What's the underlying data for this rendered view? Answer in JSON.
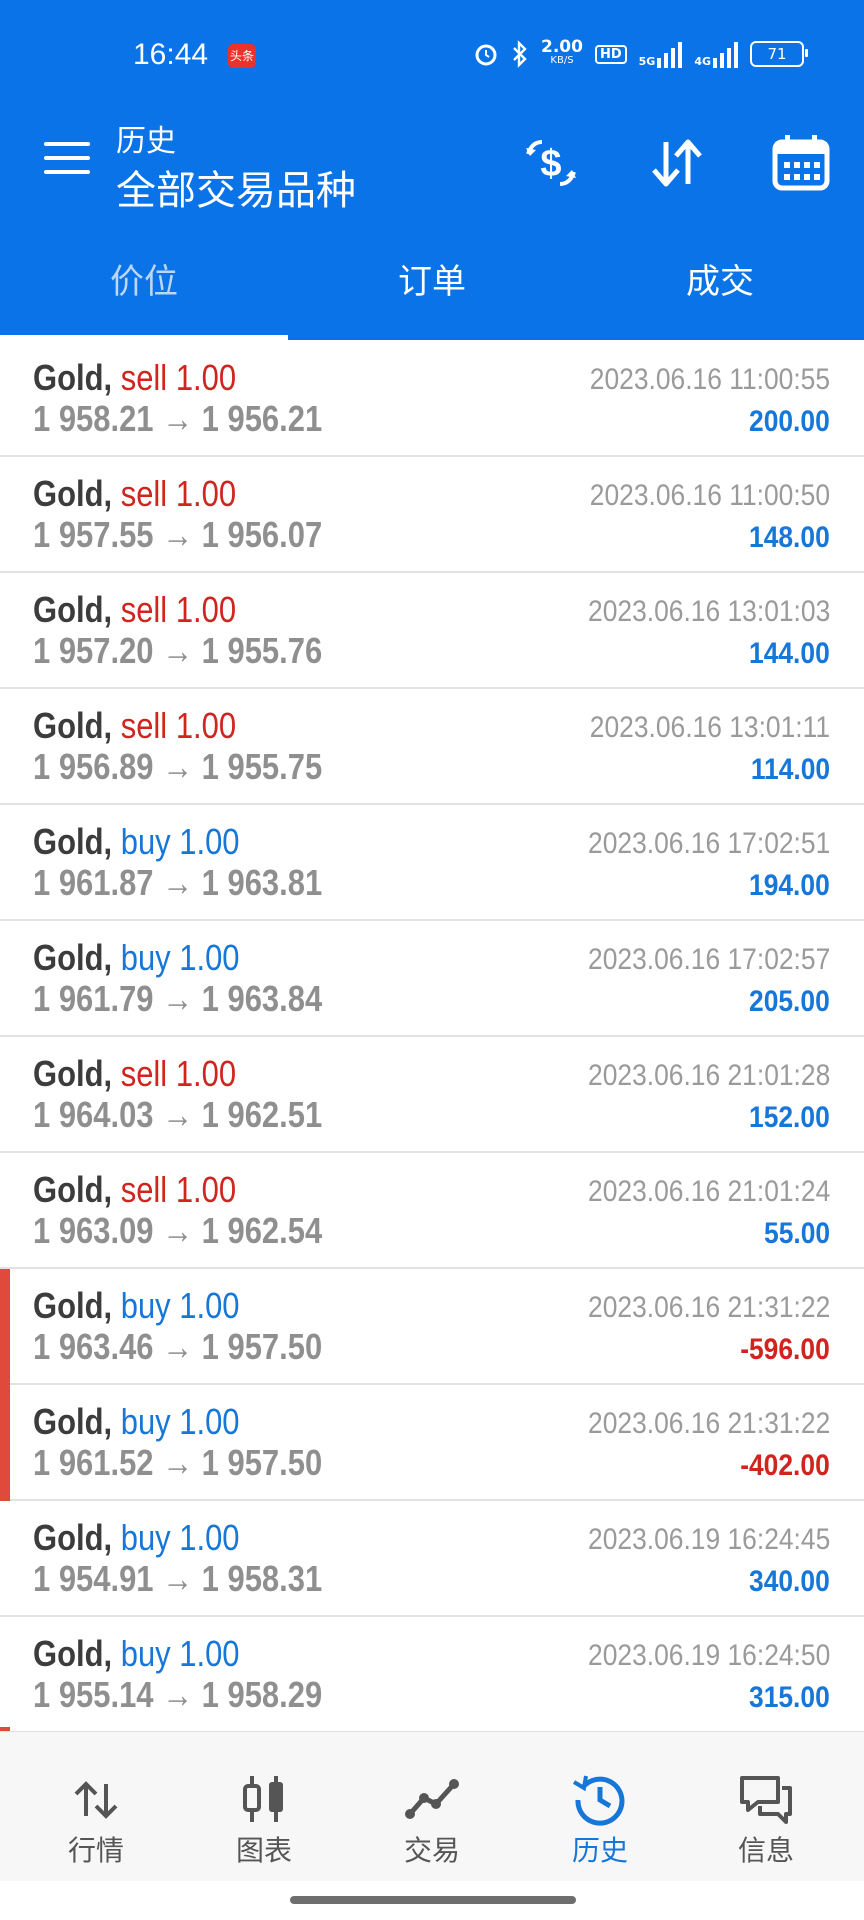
{
  "status_bar": {
    "time": "16:44",
    "badge": "头条",
    "net_speed": "2.00",
    "net_unit": "KB/S",
    "hd": "HD",
    "net1": "5G",
    "net2": "4G",
    "battery": "71"
  },
  "header": {
    "title_small": "历史",
    "title_large": "全部交易品种"
  },
  "tabs": [
    {
      "label": "价位",
      "active": true
    },
    {
      "label": "订单",
      "active": false
    },
    {
      "label": "成交",
      "active": false
    }
  ],
  "trades": [
    {
      "symbol": "Gold,",
      "side": "sell",
      "volume": "1.00",
      "prices": "1 958.21 → 1 956.21",
      "time": "2023.06.16 11:00:55",
      "profit": "200.00"
    },
    {
      "symbol": "Gold,",
      "side": "sell",
      "volume": "1.00",
      "prices": "1 957.55 → 1 956.07",
      "time": "2023.06.16 11:00:50",
      "profit": "148.00"
    },
    {
      "symbol": "Gold,",
      "side": "sell",
      "volume": "1.00",
      "prices": "1 957.20 → 1 955.76",
      "time": "2023.06.16 13:01:03",
      "profit": "144.00"
    },
    {
      "symbol": "Gold,",
      "side": "sell",
      "volume": "1.00",
      "prices": "1 956.89 → 1 955.75",
      "time": "2023.06.16 13:01:11",
      "profit": "114.00"
    },
    {
      "symbol": "Gold,",
      "side": "buy",
      "volume": "1.00",
      "prices": "1 961.87 → 1 963.81",
      "time": "2023.06.16 17:02:51",
      "profit": "194.00"
    },
    {
      "symbol": "Gold,",
      "side": "buy",
      "volume": "1.00",
      "prices": "1 961.79 → 1 963.84",
      "time": "2023.06.16 17:02:57",
      "profit": "205.00"
    },
    {
      "symbol": "Gold,",
      "side": "sell",
      "volume": "1.00",
      "prices": "1 964.03 → 1 962.51",
      "time": "2023.06.16 21:01:28",
      "profit": "152.00"
    },
    {
      "symbol": "Gold,",
      "side": "sell",
      "volume": "1.00",
      "prices": "1 963.09 → 1 962.54",
      "time": "2023.06.16 21:01:24",
      "profit": "55.00"
    },
    {
      "symbol": "Gold,",
      "side": "buy",
      "volume": "1.00",
      "prices": "1 963.46 → 1 957.50",
      "time": "2023.06.16 21:31:22",
      "profit": "-596.00"
    },
    {
      "symbol": "Gold,",
      "side": "buy",
      "volume": "1.00",
      "prices": "1 961.52 → 1 957.50",
      "time": "2023.06.16 21:31:22",
      "profit": "-402.00"
    },
    {
      "symbol": "Gold,",
      "side": "buy",
      "volume": "1.00",
      "prices": "1 954.91 → 1 958.31",
      "time": "2023.06.19 16:24:45",
      "profit": "340.00"
    },
    {
      "symbol": "Gold,",
      "side": "buy",
      "volume": "1.00",
      "prices": "1 955.14 → 1 958.29",
      "time": "2023.06.19 16:24:50",
      "profit": "315.00"
    }
  ],
  "bottom_nav": [
    {
      "label": "行情",
      "icon": "quotes-arrows-icon",
      "active": false
    },
    {
      "label": "图表",
      "icon": "chart-candles-icon",
      "active": false
    },
    {
      "label": "交易",
      "icon": "trade-line-icon",
      "active": false
    },
    {
      "label": "历史",
      "icon": "history-clock-icon",
      "active": true
    },
    {
      "label": "信息",
      "icon": "messages-icon",
      "active": false
    }
  ],
  "colors": {
    "primary": "#0a73e8",
    "sell": "#d0241e",
    "buy": "#1677d8",
    "loss_marker": "#e04a3d"
  }
}
